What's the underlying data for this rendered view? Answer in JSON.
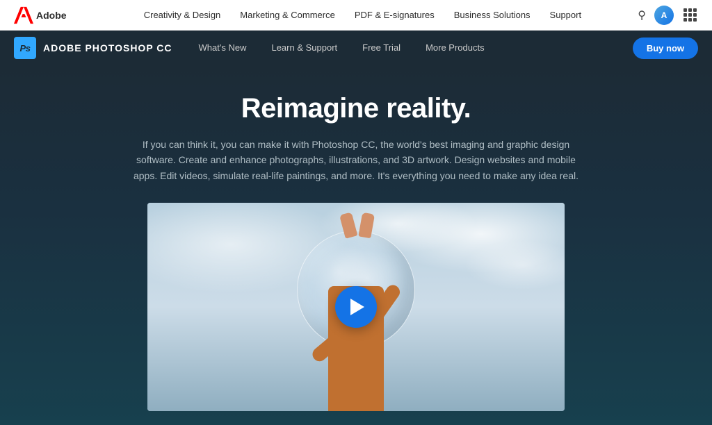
{
  "topNav": {
    "brand": "Adobe",
    "links": [
      {
        "label": "Creativity & Design"
      },
      {
        "label": "Marketing & Commerce"
      },
      {
        "label": "PDF & E-signatures"
      },
      {
        "label": "Business Solutions"
      },
      {
        "label": "Support"
      }
    ]
  },
  "productNav": {
    "psIconText": "Ps",
    "productName": "ADOBE PHOTOSHOP CC",
    "links": [
      {
        "label": "What's New"
      },
      {
        "label": "Learn & Support"
      },
      {
        "label": "Free Trial"
      },
      {
        "label": "More Products"
      }
    ],
    "buyButton": "Buy now"
  },
  "hero": {
    "headline": "Reimagine reality.",
    "description": "If you can think it, you can make it with Photoshop CC, the world's best imaging and graphic design software. Create and enhance photographs, illustrations, and 3D artwork. Design websites and mobile apps. Edit videos, simulate real-life paintings, and more. It's everything you need to make any idea real."
  }
}
